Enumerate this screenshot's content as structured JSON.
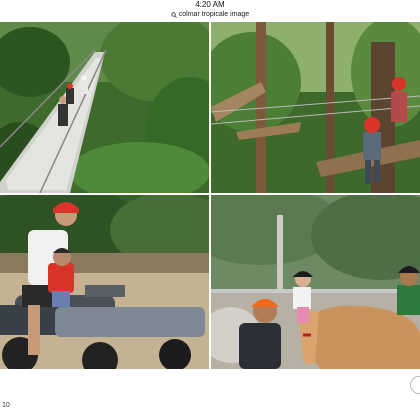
{
  "status_bar": {
    "time": "4:20 AM"
  },
  "url_bar": {
    "url": "colmar tropicale image",
    "icon": "search-lock-icon"
  },
  "photos": [
    {
      "subject": "hanging-bridge"
    },
    {
      "subject": "zipline-treetop"
    },
    {
      "subject": "atv-ride"
    },
    {
      "subject": "horse-riding"
    }
  ],
  "footer": {
    "page_number": "10"
  },
  "colors": {
    "background": "#ffffff",
    "forest": "#2f5a22",
    "helmet_red": "#d8352a",
    "helmet_orange": "#ee6a1d"
  }
}
